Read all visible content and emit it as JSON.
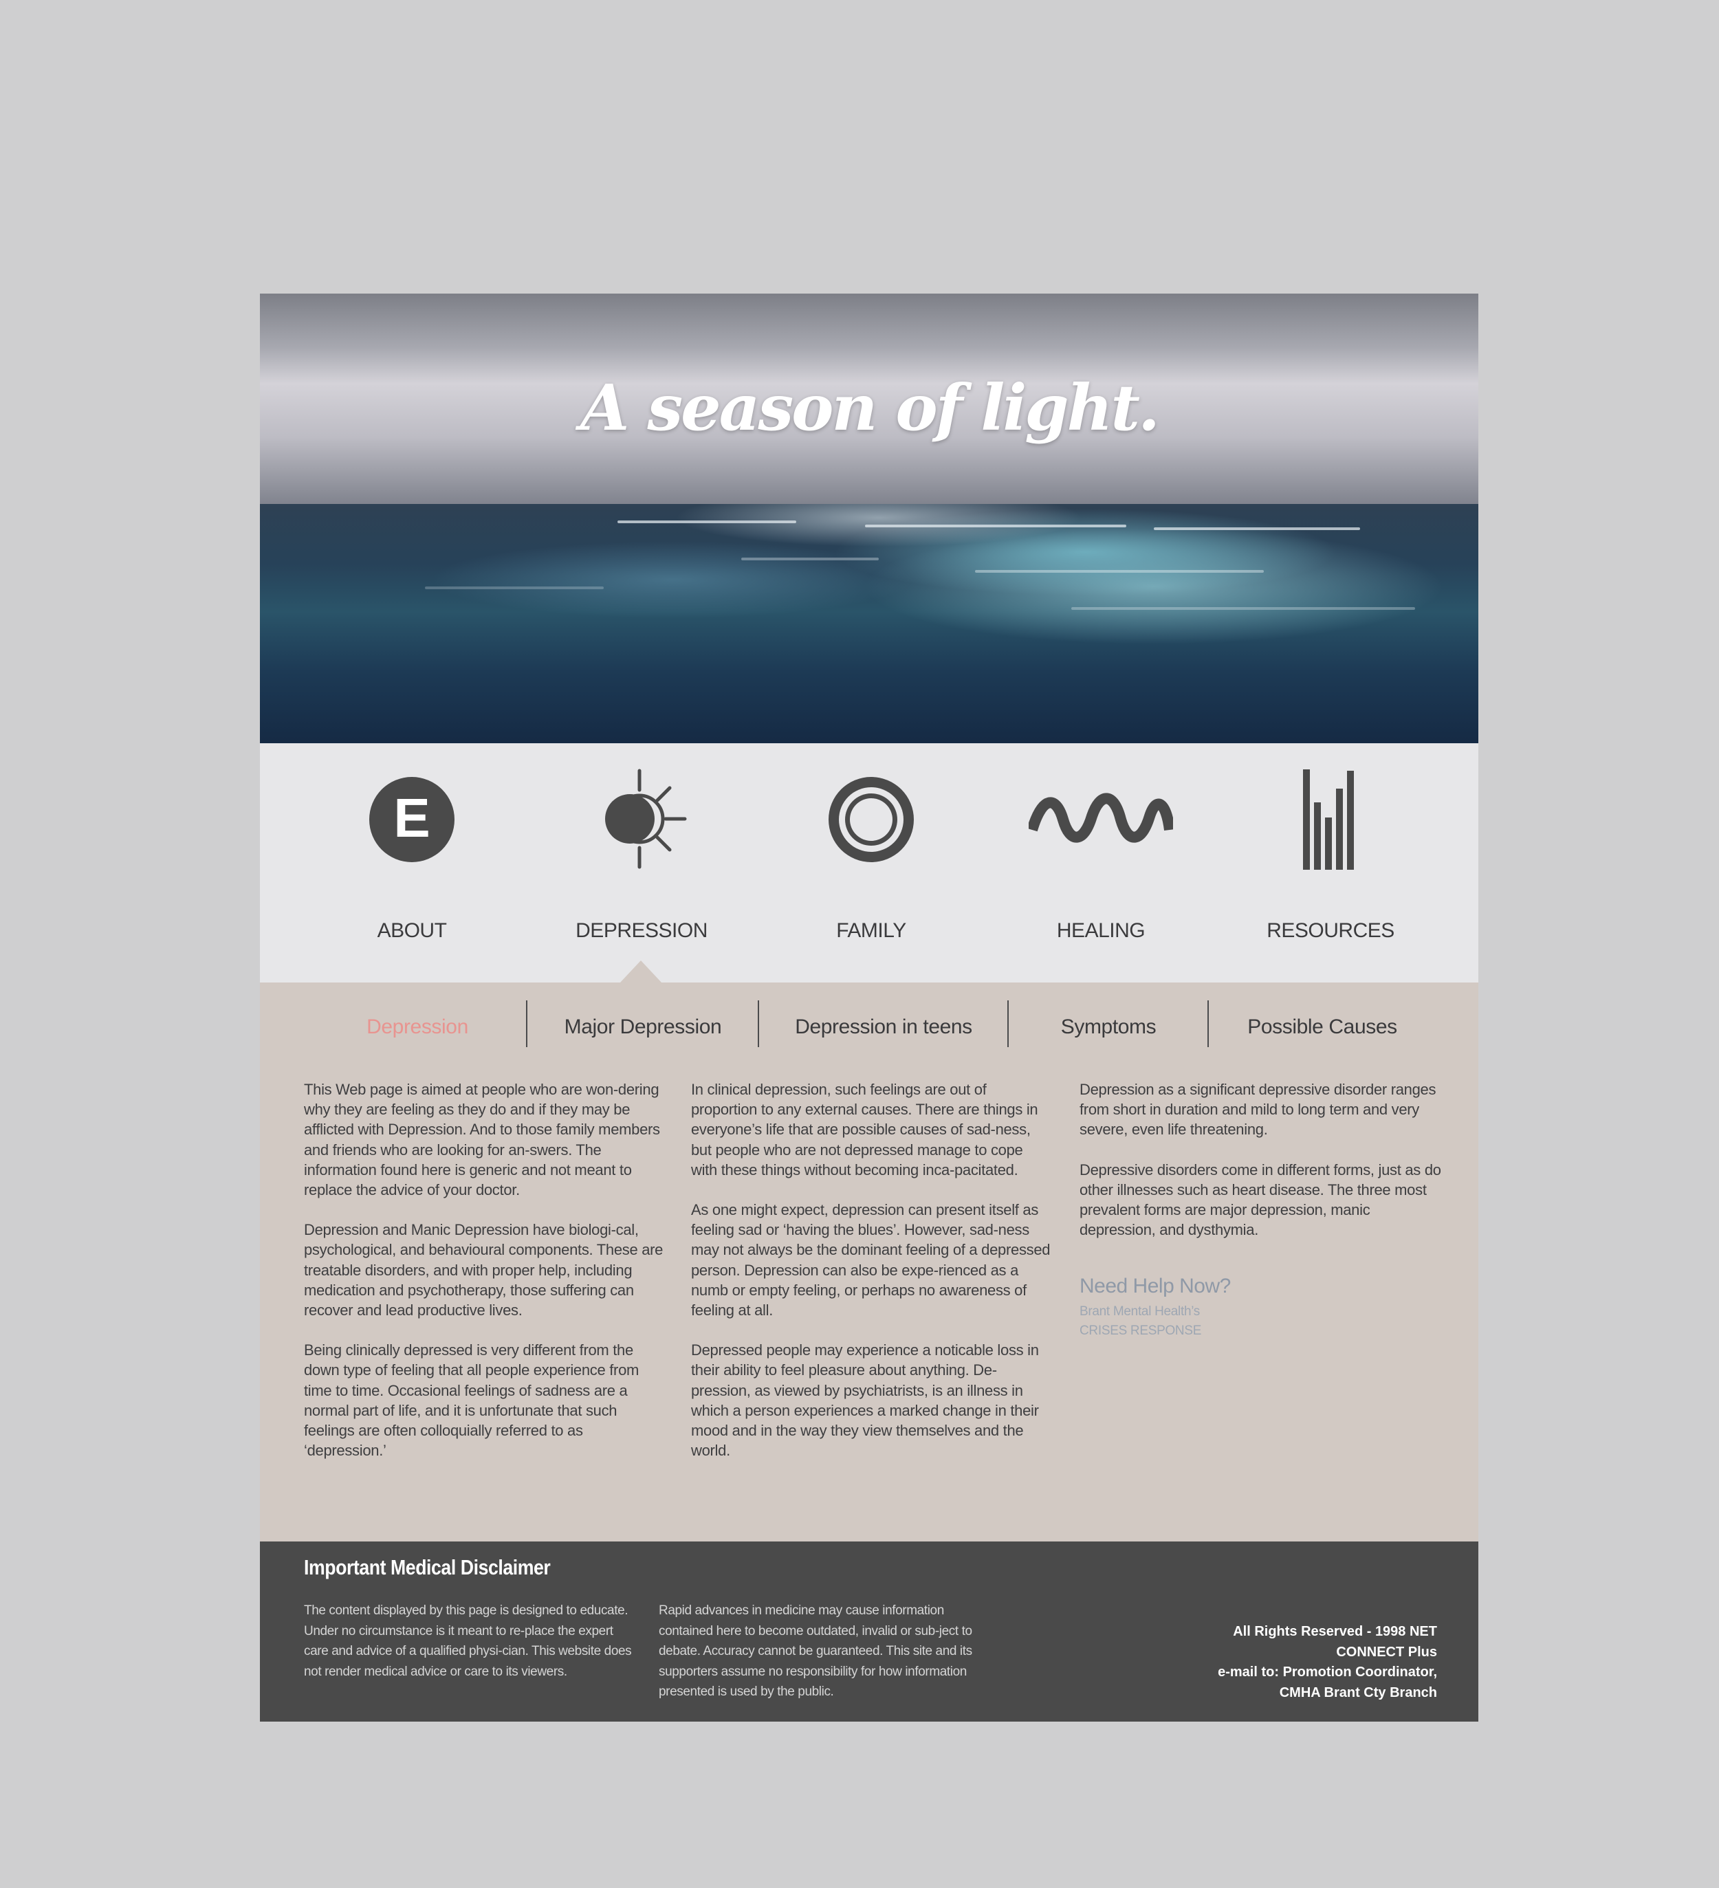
{
  "hero": {
    "title": "A season of light."
  },
  "nav": {
    "items": [
      {
        "label": "ABOUT",
        "icon": "e-circle-icon"
      },
      {
        "label": "DEPRESSION",
        "icon": "eclipse-sun-icon"
      },
      {
        "label": "FAMILY",
        "icon": "ring-icon"
      },
      {
        "label": "HEALING",
        "icon": "wave-icon"
      },
      {
        "label": "RESOURCES",
        "icon": "bars-icon"
      }
    ],
    "active_index": 1
  },
  "subnav": {
    "tabs": [
      "Depression",
      "Major Depression",
      "Depression in teens",
      "Symptoms",
      "Possible Causes"
    ],
    "active_index": 0,
    "active_color": "#e89490"
  },
  "content": {
    "col1": [
      "This Web page is aimed at people who are won-dering why they are feeling as they do and if they may be afflicted with Depression. And to those family members and friends who are looking for an-swers. The information found here is generic and not meant to replace the advice of your doctor.",
      "Depression and Manic Depression have biologi-cal, psychological, and behavioural components. These are treatable disorders, and with proper help, including medication and psychotherapy, those suffering can recover and lead productive lives.",
      "Being clinically depressed is very different from the down type of feeling that all people experience from time to time. Occasional feelings of sadness are a normal part of life, and it is unfortunate that such feelings are often colloquially referred to as ‘depression.’"
    ],
    "col2": [
      "In clinical depression, such feelings are out of proportion to any external causes. There are things in everyone’s life that are possible causes of sad-ness, but people who are not depressed manage to cope with these things without becoming inca-pacitated.",
      "As one might expect, depression can present itself as feeling sad or ‘having the blues’. However, sad-ness may not always be the dominant feeling of a depressed person. Depression can also be expe-rienced as a numb or empty feeling, or perhaps no awareness of feeling at all.",
      "Depressed people may experience a noticable loss in their ability to feel pleasure about anything. De-pression, as viewed by psychiatrists, is an illness in which a person experiences a marked change in their mood and in the way they view themselves and the world."
    ],
    "col3": [
      "Depression as a significant depressive disorder ranges from short in duration and mild to long term and very severe, even life threatening.",
      "Depressive disorders come in different forms, just as do other illnesses such as heart disease. The three most prevalent forms are major depression, manic depression, and dysthymia."
    ],
    "help": {
      "title": "Need Help Now?",
      "line1": "Brant Mental Health’s",
      "line2": "CRISES RESPONSE"
    }
  },
  "footer": {
    "title": "Important Medical Disclaimer",
    "col1": "The content displayed by this page is designed to educate. Under no circumstance is it meant to re-place the expert care and advice of a qualified physi-cian. This website does not render medical advice or care to its viewers.",
    "col2": "Rapid advances in medicine may cause information contained here to become outdated, invalid or sub-ject to debate. Accuracy cannot be guaranteed. This site and its supporters assume no responsibility for how information presented is used by the public.",
    "right": [
      "All Rights Reserved - 1998 NET",
      "CONNECT Plus",
      "e-mail to: Promotion Coordinator,",
      "CMHA Brant Cty Branch"
    ]
  },
  "colors": {
    "background": "#cfcfd0",
    "nav_bg": "#e7e7e9",
    "content_bg": "#d2c9c3",
    "footer_bg": "#4a4a4a",
    "icon_color": "#4a4a4a",
    "help_color": "#8f99a7"
  }
}
